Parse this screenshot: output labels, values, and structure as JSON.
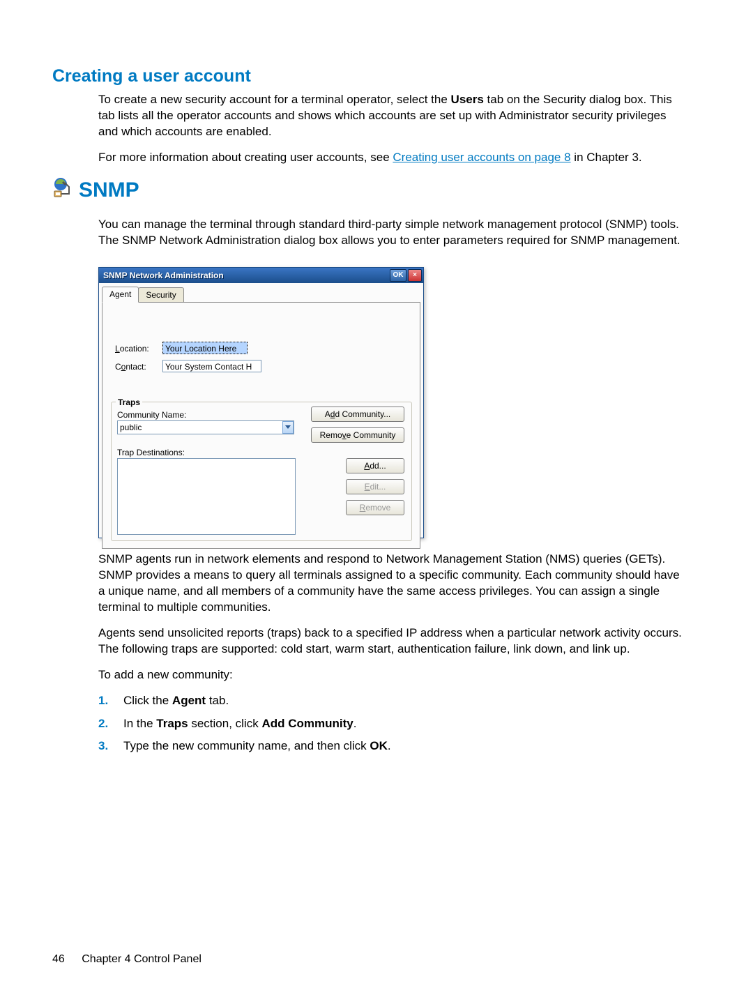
{
  "heading_create": "Creating a user account",
  "para1_a": "To create a new security account for a terminal operator, select the ",
  "para1_b": "Users",
  "para1_c": " tab on the Security dialog box. This tab lists all the operator accounts and shows which accounts are set up with Administrator security privileges and which accounts are enabled.",
  "para2_a": "For more information about creating user accounts, see ",
  "para2_link": "Creating user accounts on page 8",
  "para2_b": " in Chapter 3.",
  "heading_snmp": "SNMP",
  "para3": "You can manage the terminal through standard third-party simple network management protocol (SNMP) tools. The SNMP Network Administration dialog box allows you to enter parameters required for SNMP management.",
  "dialog": {
    "title": "SNMP Network Administration",
    "ok": "OK",
    "close": "×",
    "tabs": {
      "agent": "Agent",
      "security": "Security"
    },
    "location_label": "Location:",
    "location_underline": "L",
    "location_value": "Your Location Here",
    "contact_label": "Contact:",
    "contact_underline": "o",
    "contact_value": "Your System Contact H",
    "traps_title": "Traps",
    "community_label": "Community Name:",
    "community_value": "public",
    "add_community": "Add Community...",
    "add_community_underline": "d",
    "remove_community": "Remove Community",
    "remove_community_underline": "v",
    "trap_dest_label": "Trap Destinations:",
    "add_btn": "Add...",
    "add_btn_underline": "A",
    "edit_btn": "Edit...",
    "edit_btn_underline": "E",
    "remove_btn": "Remove",
    "remove_btn_underline": "R"
  },
  "para4": "SNMP agents run in network elements and respond to Network Management Station (NMS) queries (GETs). SNMP provides a means to query all terminals assigned to a specific community. Each community should have a unique name, and all members of a community have the same access privileges. You can assign a single terminal to multiple communities.",
  "para5": "Agents send unsolicited reports (traps) back to a specified IP address when a particular network activity occurs. The following traps are supported: cold start, warm start, authentication failure, link down, and link up.",
  "para6": "To add a new community:",
  "steps": [
    {
      "num": "1.",
      "a": "Click the ",
      "b": "Agent",
      "c": " tab."
    },
    {
      "num": "2.",
      "a": "In the ",
      "b": "Traps",
      "c": " section, click ",
      "d": "Add Community",
      "e": "."
    },
    {
      "num": "3.",
      "a": "Type the new community name, and then click ",
      "b": "OK",
      "c": "."
    }
  ],
  "footer": {
    "page": "46",
    "chapter": "Chapter 4   Control Panel"
  }
}
